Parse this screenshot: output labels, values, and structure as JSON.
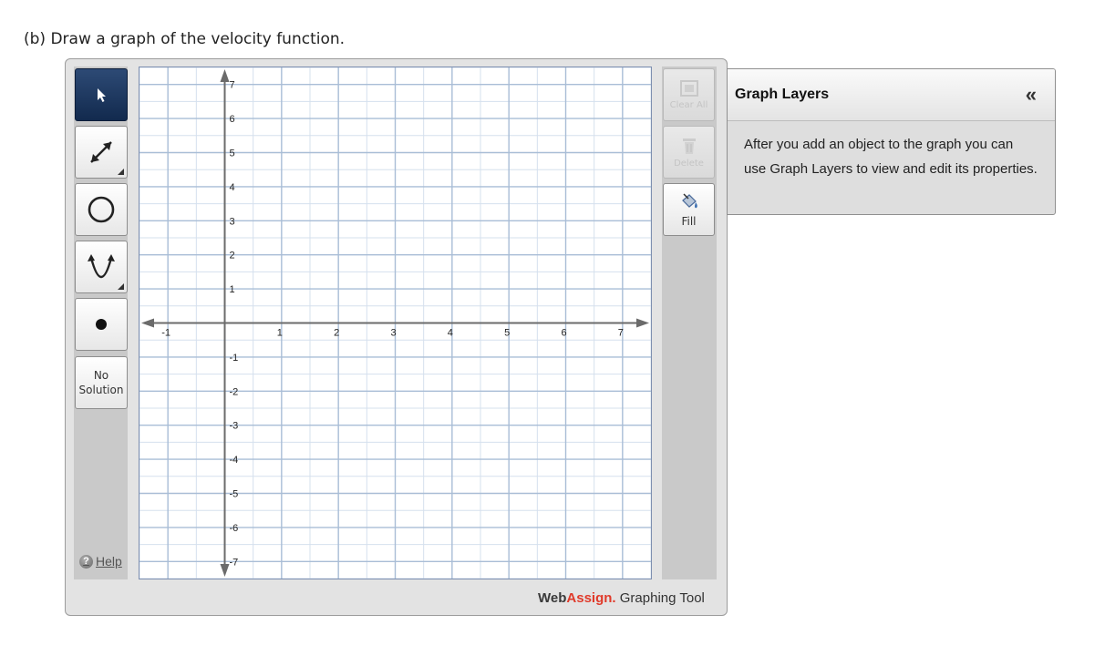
{
  "question": {
    "text": "(b)  Draw a graph of the velocity function."
  },
  "tools": [
    {
      "name": "select-tool",
      "icon": "arrow-pointer-icon",
      "active": true
    },
    {
      "name": "line-tool",
      "icon": "double-arrow-line-icon",
      "active": false
    },
    {
      "name": "circle-tool",
      "icon": "circle-icon",
      "active": false
    },
    {
      "name": "parabola-tool",
      "icon": "parabola-icon",
      "active": false
    },
    {
      "name": "point-tool",
      "icon": "dot-icon",
      "active": false
    }
  ],
  "no_solution": {
    "line1": "No",
    "line2": "Solution"
  },
  "help": {
    "label": "Help",
    "icon_glyph": "?"
  },
  "side_buttons": {
    "clear_all": "Clear All",
    "delete": "Delete",
    "fill": "Fill"
  },
  "brand": {
    "part1": "Web",
    "part2": "Assign.",
    "part3": " Graphing Tool",
    "accent_color": "#e03a2a"
  },
  "graph": {
    "x_min": -1.5,
    "x_max": 7.5,
    "y_min": -7.5,
    "y_max": 7.5,
    "x_tick_labels": [
      "-1",
      "1",
      "2",
      "3",
      "4",
      "5",
      "6",
      "7"
    ],
    "y_tick_labels": [
      "7",
      "6",
      "5",
      "4",
      "3",
      "2",
      "1",
      "-1",
      "-2",
      "-3",
      "-4",
      "-5",
      "-6",
      "-7"
    ],
    "grid_color": "#a9bdd6",
    "axis_color": "#6b6b6b"
  },
  "layers_panel": {
    "title": "Graph Layers",
    "collapse_glyph": "«",
    "body": "After you add an object to the graph you can use Graph Layers to view and edit its properties."
  }
}
